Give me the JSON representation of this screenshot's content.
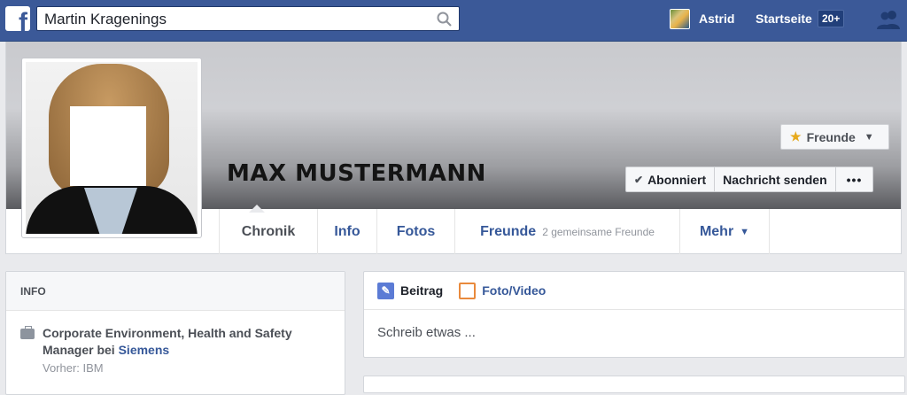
{
  "topbar": {
    "search_value": "Martin Kragenings",
    "user_name": "Astrid",
    "home_label": "Startseite",
    "home_badge": "20+"
  },
  "profile": {
    "name": "MAX MUSTERMANN",
    "friends_button": "Freunde",
    "subscribed_button": "Abonniert",
    "message_button": "Nachricht senden",
    "more_button": "•••"
  },
  "tabs": [
    {
      "label": "Chronik"
    },
    {
      "label": "Info"
    },
    {
      "label": "Fotos"
    },
    {
      "label": "Freunde",
      "sub": "2 gemeinsame Freunde"
    },
    {
      "label": "Mehr"
    }
  ],
  "info": {
    "heading": "INFO",
    "work_title": "Corporate Environment, Health and Safety Manager bei",
    "work_company": "Siemens",
    "previous": "Vorher: IBM"
  },
  "composer": {
    "tab_post": "Beitrag",
    "tab_photo": "Foto/Video",
    "placeholder": "Schreib etwas ..."
  },
  "colors": {
    "brand": "#3b5998",
    "link": "#365899",
    "background": "#e9eaed"
  }
}
